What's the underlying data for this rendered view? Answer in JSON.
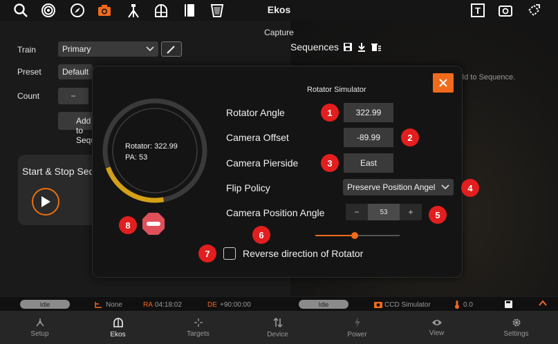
{
  "app": {
    "title": "Ekos",
    "section": "Capture"
  },
  "left_panel": {
    "train_label": "Train",
    "train_value": "Primary",
    "preset_label": "Preset",
    "preset_value": "Default",
    "count_label": "Count",
    "count_minus": "−",
    "add_sequence_label": "Add to Sequence",
    "start_stop_label": "Start & Stop Sequence"
  },
  "sequences": {
    "title": "Sequences",
    "hint": "dd to Sequence."
  },
  "dialog": {
    "title": "Rotator Simulator",
    "rotator_angle_label": "Rotator Angle",
    "rotator_angle_value": "322.99",
    "camera_offset_label": "Camera Offset",
    "camera_offset_value": "-89.99",
    "camera_pierside_label": "Camera Pierside",
    "camera_pierside_value": "East",
    "flip_policy_label": "Flip Policy",
    "flip_policy_value": "Preserve Position Angel",
    "camera_pa_label": "Camera Position Angle",
    "camera_pa_value": "53",
    "stepper_minus": "−",
    "stepper_plus": "+",
    "gauge_rotator": "Rotator: 322.99",
    "gauge_pa": "PA: 53",
    "reverse_label": "Reverse direction of Rotator",
    "reverse_checked": false,
    "slider_fraction": 0.47
  },
  "badges": [
    "1",
    "2",
    "3",
    "4",
    "5",
    "6",
    "7",
    "8"
  ],
  "status": {
    "left_state": "Idle",
    "guide": "None",
    "ra_label": "RA",
    "ra_value": "04:18:02",
    "de_label": "DE",
    "de_value": "+90:00:00",
    "right_state": "Idle",
    "camera": "CCD Simulator",
    "temp": "0.0"
  },
  "nav": [
    {
      "label": "Setup"
    },
    {
      "label": "Ekos"
    },
    {
      "label": "Targets"
    },
    {
      "label": "Device"
    },
    {
      "label": "Power"
    },
    {
      "label": "View"
    },
    {
      "label": "Settings"
    }
  ],
  "colors": {
    "accent": "#f26a1b",
    "badge": "#e21e1e",
    "gauge_arc": "#d4a017"
  }
}
